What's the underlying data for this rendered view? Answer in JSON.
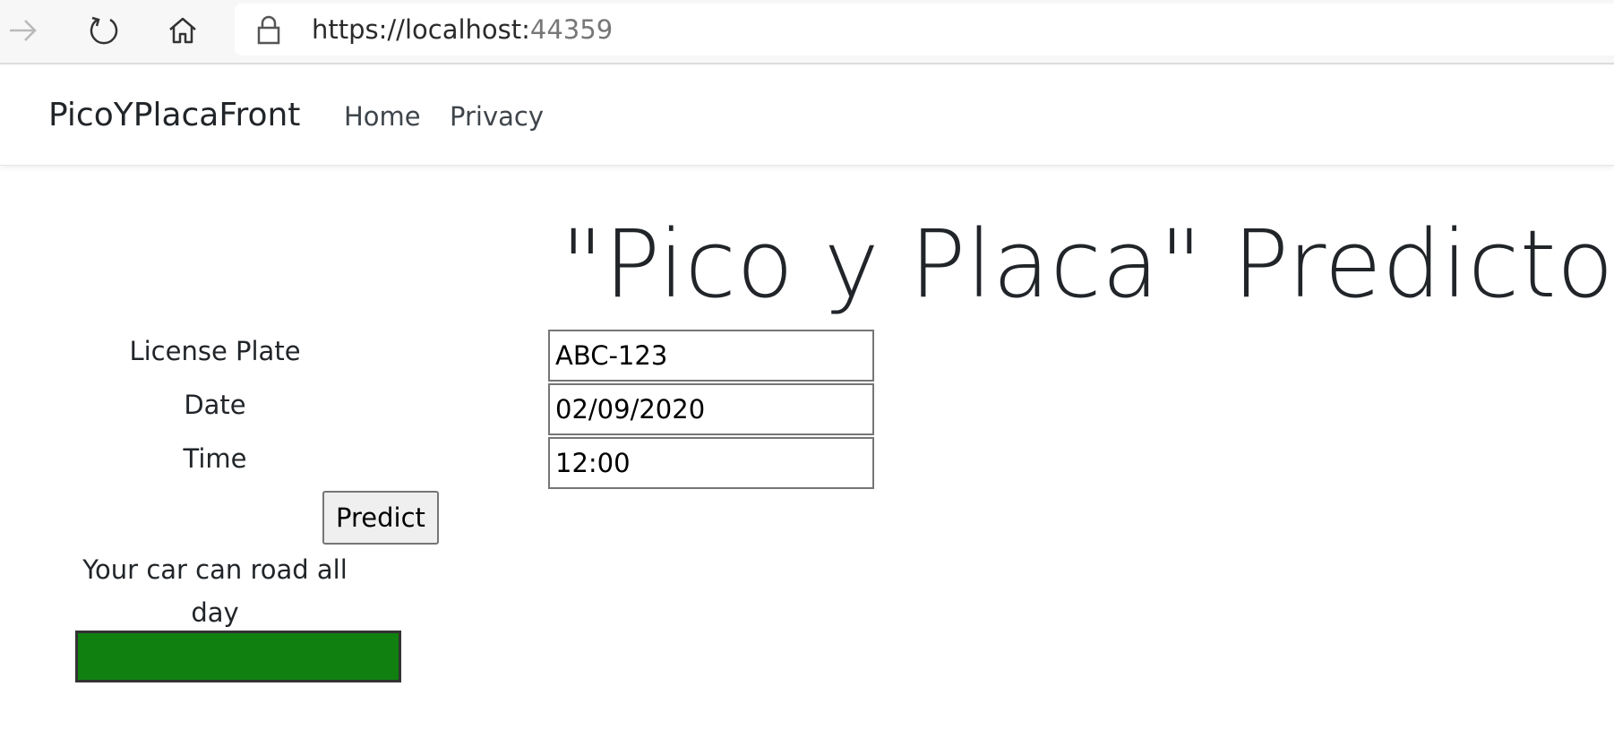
{
  "browser": {
    "url_host": "https://localhost:",
    "url_port": "44359"
  },
  "navbar": {
    "brand": "PicoYPlacaFront",
    "links": [
      {
        "label": "Home"
      },
      {
        "label": "Privacy"
      }
    ]
  },
  "main": {
    "title": "\"Pico y Placa\" Predictor",
    "form": {
      "license_plate_label": "License Plate",
      "license_plate_value": "ABC-123",
      "date_label": "Date",
      "date_value": "02/09/2020",
      "time_label": "Time",
      "time_value": "12:00",
      "predict_label": "Predict"
    },
    "result": {
      "message": "Your car can road all day",
      "status_color": "#108010"
    }
  }
}
